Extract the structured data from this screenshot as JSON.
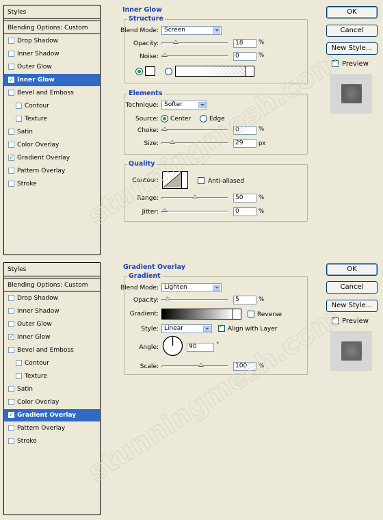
{
  "top": {
    "sidebar": {
      "title": "Styles",
      "blending": "Blending Options: Custom",
      "items": [
        {
          "label": "Drop Shadow",
          "checked": false,
          "selected": false,
          "indent": false
        },
        {
          "label": "Inner Shadow",
          "checked": false,
          "selected": false,
          "indent": false
        },
        {
          "label": "Outer Glow",
          "checked": false,
          "selected": false,
          "indent": false
        },
        {
          "label": "Inner Glow",
          "checked": true,
          "selected": true,
          "indent": false
        },
        {
          "label": "Bevel and Emboss",
          "checked": false,
          "selected": false,
          "indent": false
        },
        {
          "label": "Contour",
          "checked": false,
          "selected": false,
          "indent": true
        },
        {
          "label": "Texture",
          "checked": false,
          "selected": false,
          "indent": true
        },
        {
          "label": "Satin",
          "checked": false,
          "selected": false,
          "indent": false
        },
        {
          "label": "Color Overlay",
          "checked": false,
          "selected": false,
          "indent": false
        },
        {
          "label": "Gradient Overlay",
          "checked": true,
          "selected": false,
          "indent": false
        },
        {
          "label": "Pattern Overlay",
          "checked": false,
          "selected": false,
          "indent": false
        },
        {
          "label": "Stroke",
          "checked": false,
          "selected": false,
          "indent": false
        }
      ]
    },
    "section_title": "Inner Glow",
    "structure": {
      "title": "Structure",
      "blend_mode_label": "Blend Mode:",
      "blend_mode": "Screen",
      "opacity_label": "Opacity:",
      "opacity": "18",
      "opacity_unit": "%",
      "opacity_level": 0.18,
      "noise_label": "Noise:",
      "noise": "0",
      "noise_unit": "%",
      "noise_level": 0
    },
    "elements": {
      "title": "Elements",
      "technique_label": "Technique:",
      "technique": "Softer",
      "source_label": "Source:",
      "source_center": "Center",
      "source_edge": "Edge",
      "choke_label": "Choke:",
      "choke": "0",
      "choke_unit": "%",
      "choke_level": 0,
      "size_label": "Size:",
      "size": "29",
      "size_unit": "px",
      "size_level": 0.12
    },
    "quality": {
      "title": "Quality",
      "contour_label": "Contour:",
      "anti_aliased": "Anti-aliased",
      "range_label": "Range:",
      "range": "50",
      "range_unit": "%",
      "range_level": 0.5,
      "jitter_label": "Jitter:",
      "jitter": "0",
      "jitter_unit": "%",
      "jitter_level": 0
    },
    "buttons": {
      "ok": "OK",
      "cancel": "Cancel",
      "new_style": "New Style...",
      "preview": "Preview"
    }
  },
  "bottom": {
    "sidebar": {
      "title": "Styles",
      "blending": "Blending Options: Custom",
      "items": [
        {
          "label": "Drop Shadow",
          "checked": false,
          "selected": false,
          "indent": false
        },
        {
          "label": "Inner Shadow",
          "checked": false,
          "selected": false,
          "indent": false
        },
        {
          "label": "Outer Glow",
          "checked": false,
          "selected": false,
          "indent": false
        },
        {
          "label": "Inner Glow",
          "checked": true,
          "selected": false,
          "indent": false
        },
        {
          "label": "Bevel and Emboss",
          "checked": false,
          "selected": false,
          "indent": false
        },
        {
          "label": "Contour",
          "checked": false,
          "selected": false,
          "indent": true
        },
        {
          "label": "Texture",
          "checked": false,
          "selected": false,
          "indent": true
        },
        {
          "label": "Satin",
          "checked": false,
          "selected": false,
          "indent": false
        },
        {
          "label": "Color Overlay",
          "checked": false,
          "selected": false,
          "indent": false
        },
        {
          "label": "Gradient Overlay",
          "checked": true,
          "selected": true,
          "indent": false
        },
        {
          "label": "Pattern Overlay",
          "checked": false,
          "selected": false,
          "indent": false
        },
        {
          "label": "Stroke",
          "checked": false,
          "selected": false,
          "indent": false
        }
      ]
    },
    "section_title": "Gradient Overlay",
    "gradient": {
      "title": "Gradient",
      "blend_mode_label": "Blend Mode:",
      "blend_mode": "Lighten",
      "opacity_label": "Opacity:",
      "opacity": "5",
      "opacity_unit": "%",
      "opacity_level": 0.05,
      "gradient_label": "Gradient:",
      "reverse": "Reverse",
      "style_label": "Style:",
      "style": "Linear",
      "align": "Align with Layer",
      "angle_label": "Angle:",
      "angle": "90",
      "angle_unit": "°",
      "scale_label": "Scale:",
      "scale": "100",
      "scale_unit": "%",
      "scale_level": 0.6
    },
    "buttons": {
      "ok": "OK",
      "cancel": "Cancel",
      "new_style": "New Style...",
      "preview": "Preview"
    }
  },
  "watermark": "stunningmesh.com",
  "colors": {
    "selection": "#316ac5",
    "group_title": "#1d3fb7",
    "background": "#ece9d8"
  }
}
